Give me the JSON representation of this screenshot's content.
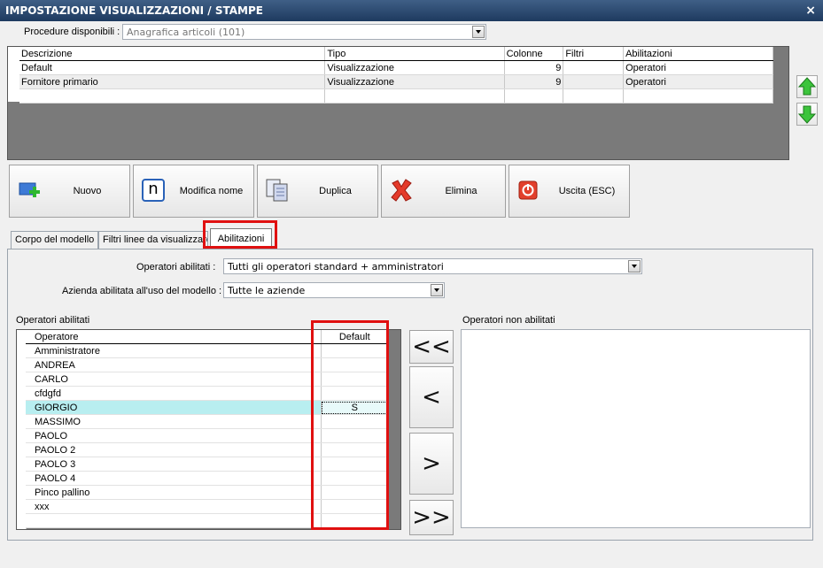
{
  "window": {
    "title": "IMPOSTAZIONE VISUALIZZAZIONI / STAMPE",
    "close": "×"
  },
  "procedure": {
    "label": "Procedure disponibili :",
    "value": "Anagrafica articoli (101)"
  },
  "models_table": {
    "columns": [
      "Descrizione",
      "Tipo",
      "Colonne",
      "Filtri",
      "Abilitazioni"
    ],
    "rows": [
      {
        "descrizione": "Default",
        "tipo": "Visualizzazione",
        "colonne": "9",
        "filtri": "",
        "abilitazioni": "Operatori"
      },
      {
        "descrizione": "Fornitore primario",
        "tipo": "Visualizzazione",
        "colonne": "9",
        "filtri": "",
        "abilitazioni": "Operatori"
      }
    ]
  },
  "toolbar": {
    "nuovo": "Nuovo",
    "modifica": "Modifica nome",
    "modifica_glyph": "n",
    "duplica": "Duplica",
    "elimina": "Elimina",
    "uscita": "Uscita (ESC)"
  },
  "tabs": [
    "Corpo del modello",
    "Filtri linee da visualizzare",
    "Abilitazioni"
  ],
  "abilitazioni": {
    "operatori_label": "Operatori abilitati :",
    "operatori_value": "Tutti gli operatori standard + amministratori",
    "azienda_label": "Azienda abilitata all'uso del modello :",
    "azienda_value": "Tutte le aziende",
    "enabled_title": "Operatori abilitati",
    "disabled_title": "Operatori non abilitati",
    "columns": [
      "Operatore",
      "Default"
    ],
    "operators": [
      {
        "name": "Amministratore",
        "default": ""
      },
      {
        "name": "ANDREA",
        "default": ""
      },
      {
        "name": "CARLO",
        "default": ""
      },
      {
        "name": "cfdgfd",
        "default": ""
      },
      {
        "name": "GIORGIO",
        "default": "S"
      },
      {
        "name": "MASSIMO",
        "default": ""
      },
      {
        "name": "PAOLO",
        "default": ""
      },
      {
        "name": "PAOLO 2",
        "default": ""
      },
      {
        "name": "PAOLO 3",
        "default": ""
      },
      {
        "name": "PAOLO 4",
        "default": ""
      },
      {
        "name": "Pinco pallino",
        "default": ""
      },
      {
        "name": "xxx",
        "default": ""
      }
    ],
    "move_buttons": {
      "all_left": "<<",
      "left": "<",
      "right": ">",
      "all_right": ">>"
    }
  },
  "colors": {
    "titlebar": "#2b4a70",
    "highlight": "#e01010",
    "selected_row": "#b8eef0"
  }
}
